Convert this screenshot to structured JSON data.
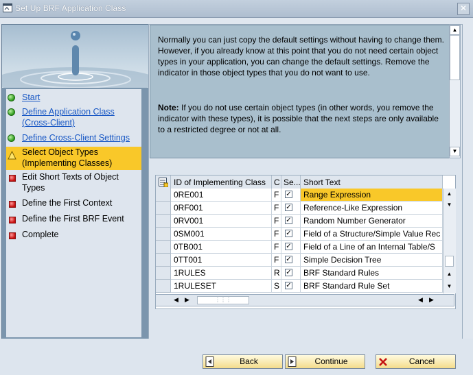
{
  "window": {
    "title": "Set Up BRF Application Class"
  },
  "steps": [
    {
      "label": "Start",
      "state": "done"
    },
    {
      "label": "Define Application Class (Cross-Client)",
      "state": "done"
    },
    {
      "label": "Define Cross-Client Settings",
      "state": "done"
    },
    {
      "label": "Select Object Types (Implementing Classes)",
      "state": "current"
    },
    {
      "label": "Edit Short Texts of Object Types",
      "state": "todo"
    },
    {
      "label": "Define the First Context",
      "state": "todo"
    },
    {
      "label": "Define the First BRF Event",
      "state": "todo"
    },
    {
      "label": "Complete",
      "state": "todo"
    }
  ],
  "info": {
    "paragraph1": "Normally you can just copy the default settings without having to change them. However, if you already know at this point that you do not need certain object types in your application, you can change the default settings. Remove the indicator in those object types that you do not want to use.",
    "note_label": "Note:",
    "note_text": " If you do not use certain object types (in other words, you remove the indicator with these types), it is possible that the next steps are only available to a restricted degree or not at all."
  },
  "table": {
    "columns": {
      "id": "ID of Implementing Class",
      "c": "C",
      "se": "Se...",
      "short": "Short Text"
    },
    "rows": [
      {
        "id": "0RE001",
        "c": "F",
        "checked": true,
        "short": "Range Expression"
      },
      {
        "id": "0RF001",
        "c": "F",
        "checked": true,
        "short": "Reference-Like Expression"
      },
      {
        "id": "0RV001",
        "c": "F",
        "checked": true,
        "short": "Random Number Generator"
      },
      {
        "id": "0SM001",
        "c": "F",
        "checked": true,
        "short": "Field of a Structure/Simple Value Rec"
      },
      {
        "id": "0TB001",
        "c": "F",
        "checked": true,
        "short": "Field of a Line of an Internal Table/S"
      },
      {
        "id": "0TT001",
        "c": "F",
        "checked": true,
        "short": "Simple Decision Tree"
      },
      {
        "id": "1RULES",
        "c": "R",
        "checked": true,
        "short": "BRF Standard Rules"
      },
      {
        "id": "1RULESET",
        "c": "S",
        "checked": true,
        "short": "BRF Standard Rule Set"
      }
    ],
    "check_mark": "✓"
  },
  "buttons": {
    "back": "Back",
    "continue": "Continue",
    "cancel": "Cancel"
  },
  "colors": {
    "current_step": "#f9c829",
    "link": "#1656c4",
    "info_bg": "#a9bfcd"
  }
}
